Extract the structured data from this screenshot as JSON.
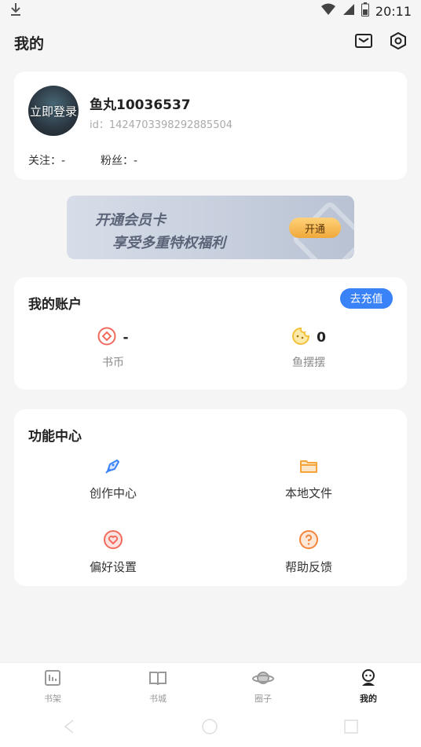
{
  "status_bar": {
    "time": "20:11",
    "download_icon": "download-icon",
    "wifi_icon": "wifi-icon",
    "signal_icon": "signal-icon",
    "battery_icon": "battery-icon"
  },
  "header": {
    "title": "我的",
    "mail_icon": "mail-icon",
    "settings_icon": "settings-icon"
  },
  "profile": {
    "avatar_text": "立即登录",
    "username": "鱼丸10036537",
    "user_id": "id：1424703398292885504",
    "following": "关注：-",
    "fans": "粉丝：-"
  },
  "vip_banner": {
    "line1": "开通会员卡",
    "line2": "享受多重特权福利",
    "button": "开通"
  },
  "account": {
    "title": "我的账户",
    "recharge_button": "去充值",
    "stats": [
      {
        "value": "-",
        "label": "书币",
        "icon": "coin-icon",
        "color": "#f06b5d"
      },
      {
        "value": "0",
        "label": "鱼摆摆",
        "icon": "fish-face-icon",
        "color": "#f3c13a"
      }
    ]
  },
  "features": {
    "title": "功能中心",
    "items": [
      {
        "label": "创作中心",
        "icon": "pen-icon",
        "color": "#3a82f7"
      },
      {
        "label": "本地文件",
        "icon": "folder-icon",
        "color": "#f3a53a"
      },
      {
        "label": "偏好设置",
        "icon": "heart-icon",
        "color": "#f06b5d"
      },
      {
        "label": "帮助反馈",
        "icon": "help-icon",
        "color": "#f3843a"
      }
    ]
  },
  "tabbar": {
    "tabs": [
      {
        "label": "书架",
        "icon": "bookshelf-icon"
      },
      {
        "label": "书城",
        "icon": "book-store-icon"
      },
      {
        "label": "圈子",
        "icon": "planet-icon"
      },
      {
        "label": "我的",
        "icon": "profile-icon",
        "active": true
      }
    ]
  },
  "nav": {
    "back_icon": "back-icon",
    "home_icon": "home-icon",
    "recent_icon": "recent-apps-icon"
  }
}
